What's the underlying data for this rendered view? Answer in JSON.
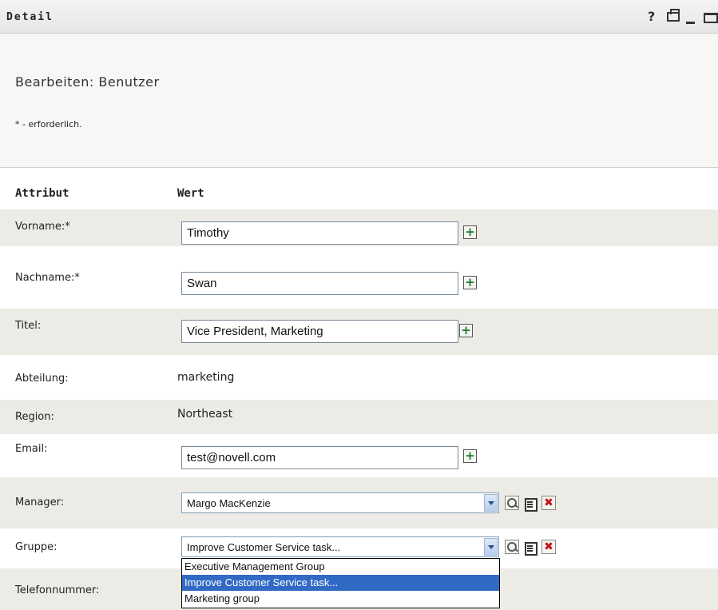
{
  "window": {
    "title": "Detail",
    "help_glyph": "?"
  },
  "header": {
    "page_title": "Bearbeiten: Benutzer",
    "required_note": "* - erforderlich."
  },
  "table": {
    "col_attribute": "Attribut",
    "col_value": "Wert"
  },
  "rows": {
    "vorname": {
      "label": "Vorname:*",
      "value": "Timothy"
    },
    "nachname": {
      "label": "Nachname:*",
      "value": "Swan"
    },
    "titel": {
      "label": "Titel:",
      "value": "Vice President, Marketing"
    },
    "abteilung": {
      "label": "Abteilung:",
      "value": "marketing"
    },
    "region": {
      "label": "Region:",
      "value": "Northeast"
    },
    "email": {
      "label": "Email:",
      "value": "test@novell.com"
    },
    "manager": {
      "label": "Manager:",
      "value": "Margo MacKenzie"
    },
    "gruppe": {
      "label": "Gruppe:",
      "value": "Improve Customer Service task..."
    },
    "telefon": {
      "label": "Telefonnummer:"
    }
  },
  "buttons": {
    "plus_glyph": "+",
    "clear_glyph": "✖"
  },
  "gruppe_dropdown": {
    "options": [
      "Executive Management Group",
      "Improve Customer Service task...",
      "Marketing group"
    ],
    "selected_index": 1
  },
  "icons": {
    "add": "plus-icon",
    "search": "search-icon",
    "history": "history-icon",
    "clear": "clear-icon",
    "print": "print-icon",
    "minimize": "minimize-icon",
    "maximize": "maximize-icon",
    "help": "help-icon"
  },
  "colors": {
    "row_shade": "#ecebe6",
    "selection": "#316ac5",
    "add_green": "#1d7a2a",
    "clear_red": "#c8141c"
  }
}
